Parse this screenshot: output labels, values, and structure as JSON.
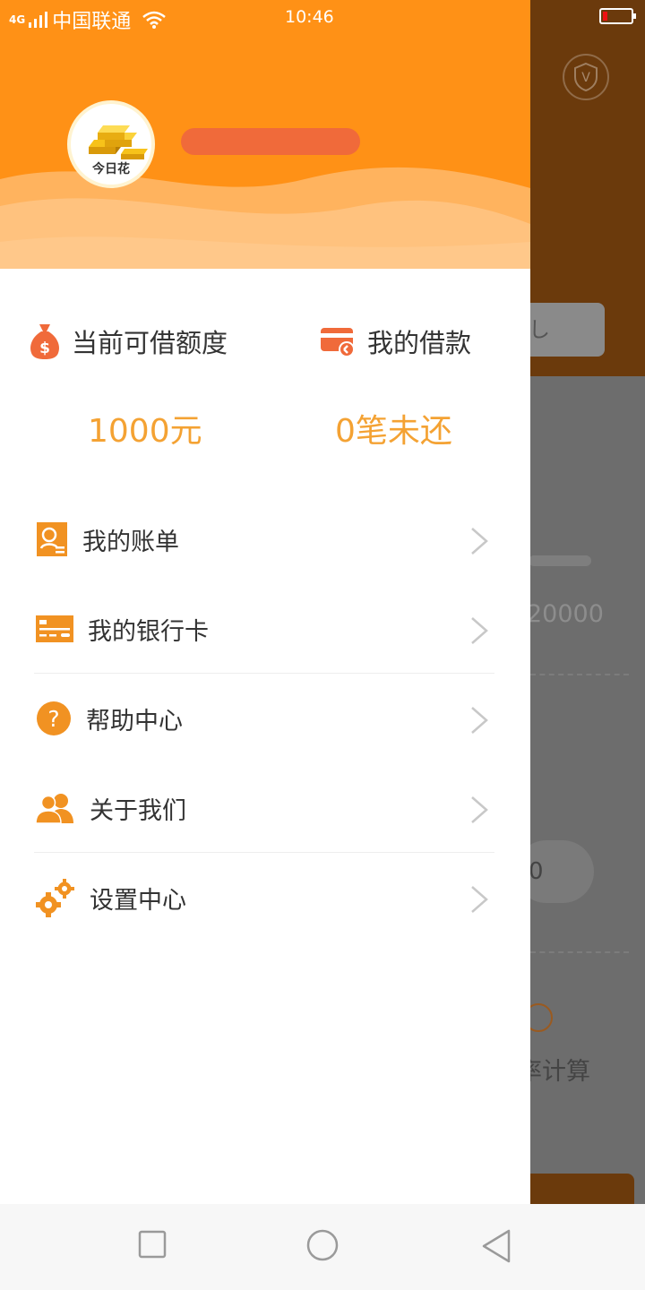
{
  "status_bar": {
    "network": "4G",
    "carrier": "中国联通",
    "time": "10:46"
  },
  "drawer": {
    "brand_label": "今日花",
    "stats": {
      "credit": {
        "title": "当前可借额度",
        "value": "1000元",
        "icon": "money-bag-icon"
      },
      "loans": {
        "title": "我的借款",
        "value": "0笔未还",
        "icon": "card-icon"
      }
    },
    "menu": [
      {
        "label": "我的账单",
        "icon": "bill-search-icon"
      },
      {
        "label": "我的银行卡",
        "icon": "bank-card-icon"
      },
      {
        "label": "帮助中心",
        "icon": "help-icon"
      },
      {
        "label": "关于我们",
        "icon": "users-icon"
      },
      {
        "label": "设置中心",
        "icon": "gears-icon"
      }
    ]
  },
  "background_app": {
    "amount_text": "20000",
    "pill_text": "0",
    "calc_text": "率计算",
    "box_text": "し"
  },
  "colors": {
    "brand_orange": "#ff9116",
    "value_orange": "#f4a233",
    "icon_orange": "#f19222"
  }
}
